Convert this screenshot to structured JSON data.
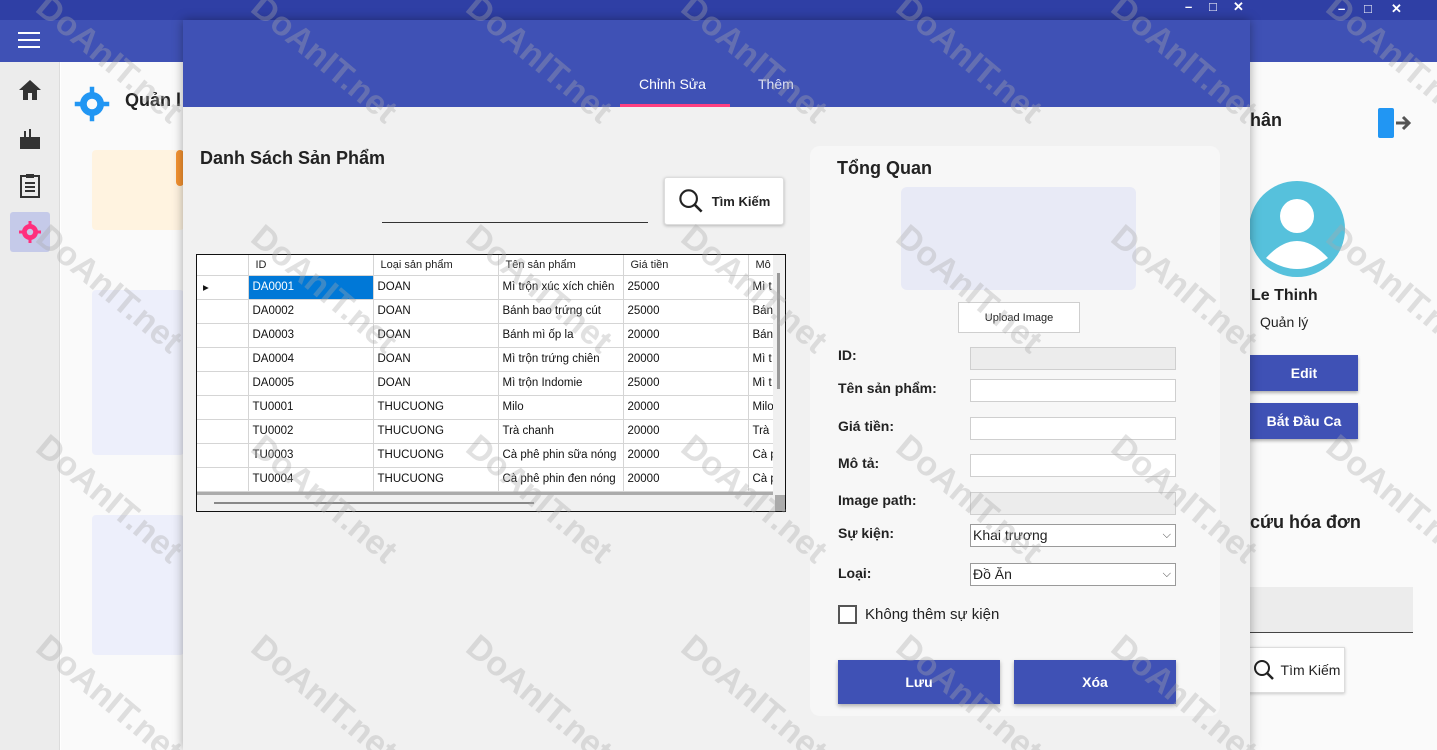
{
  "colors": {
    "primary": "#3f51b5",
    "accent": "#ff4081",
    "selected": "#0078d7"
  },
  "main_window": {
    "menu_icon": "hamburger-icon",
    "window_controls": [
      "–",
      "□",
      "✕"
    ],
    "sidebar": [
      "home-icon",
      "product-icon",
      "clipboard-icon",
      "settings-icon"
    ],
    "heading": "Quản l",
    "right_panel": {
      "title": "hân",
      "name": "Le Thinh",
      "role": "Quản lý",
      "edit_label": "Edit",
      "start_shift_label": "Bắt Đầu Ca",
      "section_title": "cứu hóa đơn",
      "search_label": "Tìm Kiếm"
    }
  },
  "dialog": {
    "window_controls": [
      "–",
      "□",
      "✕"
    ],
    "tabs": [
      {
        "label": "Chỉnh Sửa",
        "active": true
      },
      {
        "label": "Thêm",
        "active": false
      }
    ],
    "list_title": "Danh Sách Sản Phẩm",
    "search": {
      "value": "",
      "button_label": "Tìm Kiếm"
    },
    "grid": {
      "columns": [
        "ID",
        "Loại sản phẩm",
        "Tên sản phẩm",
        "Giá tiền",
        "Mô"
      ],
      "rows": [
        [
          "DA0001",
          "DOAN",
          "Mì trộn xúc xích chiên",
          "25000",
          "Mì t"
        ],
        [
          "DA0002",
          "DOAN",
          "Bánh bao trứng cút",
          "25000",
          "Bán"
        ],
        [
          "DA0003",
          "DOAN",
          "Bánh mì ốp la",
          "20000",
          "Bán"
        ],
        [
          "DA0004",
          "DOAN",
          "Mì trộn trứng chiên",
          "20000",
          "Mì t"
        ],
        [
          "DA0005",
          "DOAN",
          "Mì trộn Indomie",
          "25000",
          "Mì t"
        ],
        [
          "TU0001",
          "THUCUONG",
          "Milo",
          "20000",
          "Milo"
        ],
        [
          "TU0002",
          "THUCUONG",
          "Trà chanh",
          "20000",
          "Trà"
        ],
        [
          "TU0003",
          "THUCUONG",
          "Cà phê phin sữa nóng",
          "20000",
          "Cà p"
        ],
        [
          "TU0004",
          "THUCUONG",
          "Cà phê phin đen nóng",
          "20000",
          "Cà p"
        ]
      ]
    },
    "overview": {
      "title": "Tổng Quan",
      "upload_label": "Upload Image",
      "fields": {
        "id_label": "ID:",
        "name_label": "Tên sản phẩm:",
        "price_label": "Giá tiền:",
        "desc_label": "Mô tả:",
        "image_path_label": "Image path:",
        "event_label": "Sự kiện:",
        "event_value": "Khai trương",
        "type_label": "Loại:",
        "type_value": "Đồ Ăn"
      },
      "checkbox_label": "Không thêm sự kiện",
      "save_label": "Lưu",
      "delete_label": "Xóa"
    }
  },
  "watermark": "DoAnIT.net"
}
